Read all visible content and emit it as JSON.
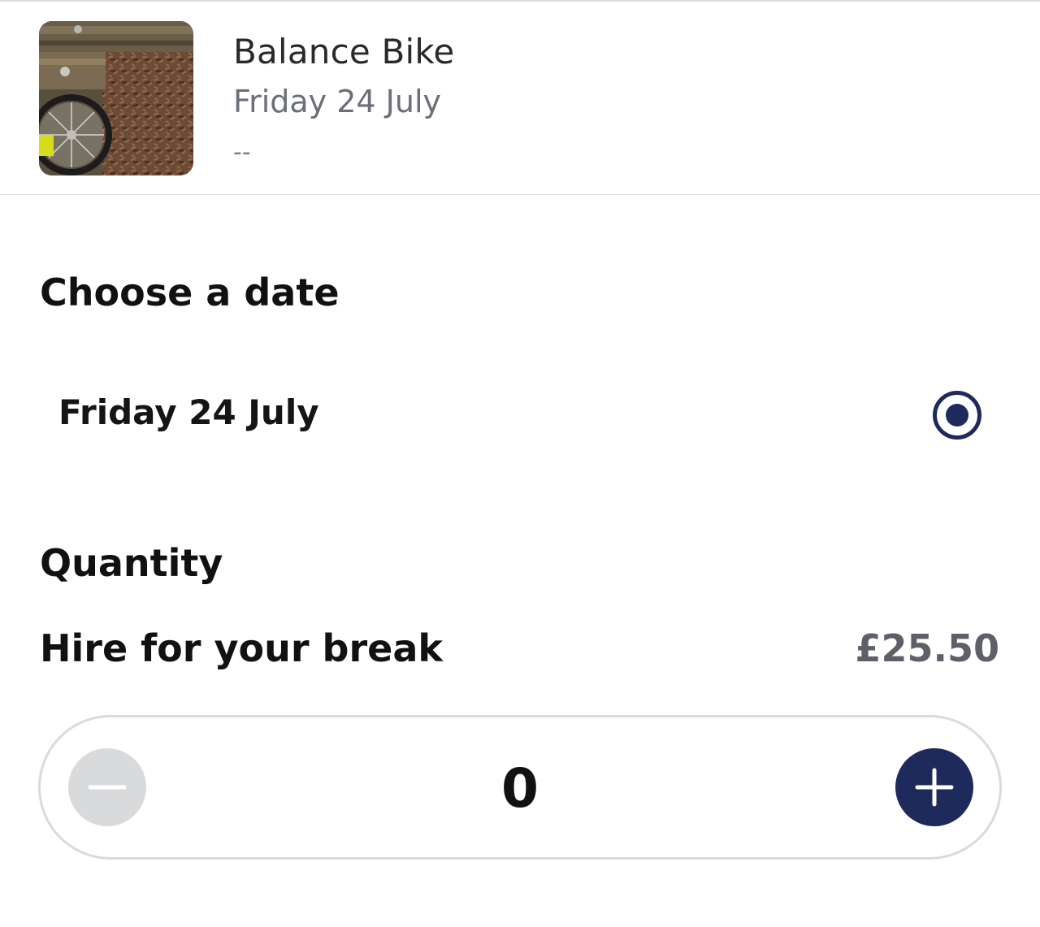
{
  "product": {
    "name": "Balance Bike",
    "date": "Friday 24 July",
    "extra": "--"
  },
  "date_section": {
    "title": "Choose a date",
    "options": [
      {
        "label": "Friday 24 July",
        "selected": true
      }
    ]
  },
  "quantity_section": {
    "title": "Quantity",
    "item_label": "Hire for your break",
    "price": "£25.50",
    "value": "0"
  },
  "colors": {
    "accent": "#1f2a5c",
    "disabled": "#d9dadc",
    "price": "#5d6068",
    "muted_text": "#6b6f76"
  },
  "icons": {
    "thumbnail": "balance-bike-photo",
    "radio": "radio-selected-icon",
    "decrement": "minus-icon",
    "increment": "plus-icon"
  }
}
